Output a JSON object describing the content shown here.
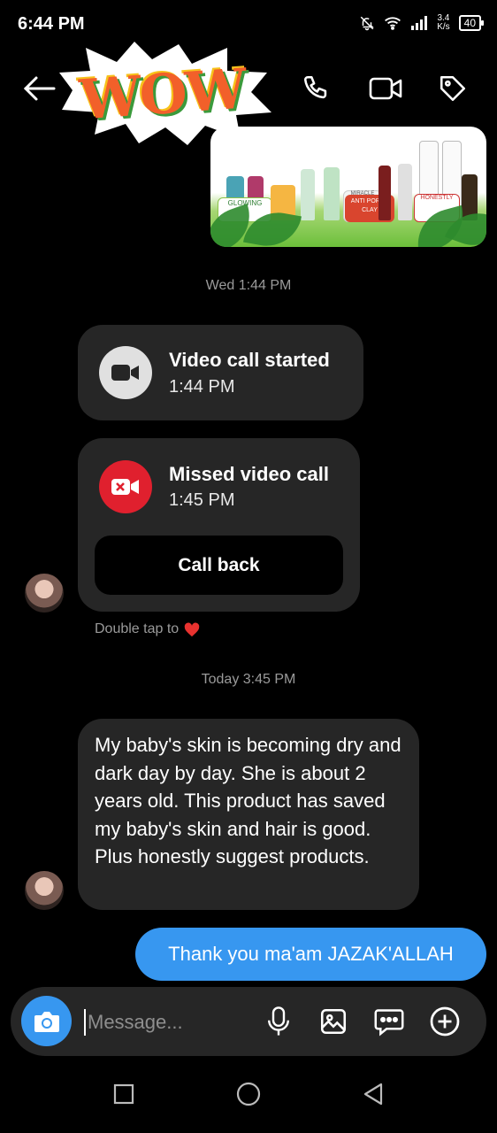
{
  "status_bar": {
    "time": "6:44 PM",
    "net_speed_value": "3.4",
    "net_speed_unit": "K/s",
    "battery": "40"
  },
  "header": {
    "sticker_text": "WOW",
    "icons": [
      "back-arrow-icon",
      "phone-icon",
      "video-camera-icon",
      "tag-icon"
    ]
  },
  "thread": {
    "timestamp_1": "Wed 1:44 PM",
    "video_call": {
      "title": "Video call started",
      "time": "1:44 PM"
    },
    "missed_call": {
      "title": "Missed video call",
      "time": "1:45 PM",
      "callback_label": "Call back"
    },
    "double_tap_hint": "Double tap to",
    "timestamp_2": "Today 3:45 PM",
    "received_message": "My baby's skin is becoming dry and dark day by day. She is about 2 years old. This product has saved my baby's skin and hair is good. Plus honestly suggest products.",
    "sent_message": "Thank you ma'am JAZAK'ALLAH"
  },
  "product_image": {
    "labels": [
      "GLOWING",
      "MIRACLE CREAM",
      "ANTI PORES CLAY",
      "HONESTLY"
    ]
  },
  "composer": {
    "placeholder": "Message..."
  },
  "colors": {
    "accent_blue": "#3797f0",
    "bubble_gray": "#262626",
    "missed_red": "#e0202e",
    "heart": "#e8322f"
  }
}
